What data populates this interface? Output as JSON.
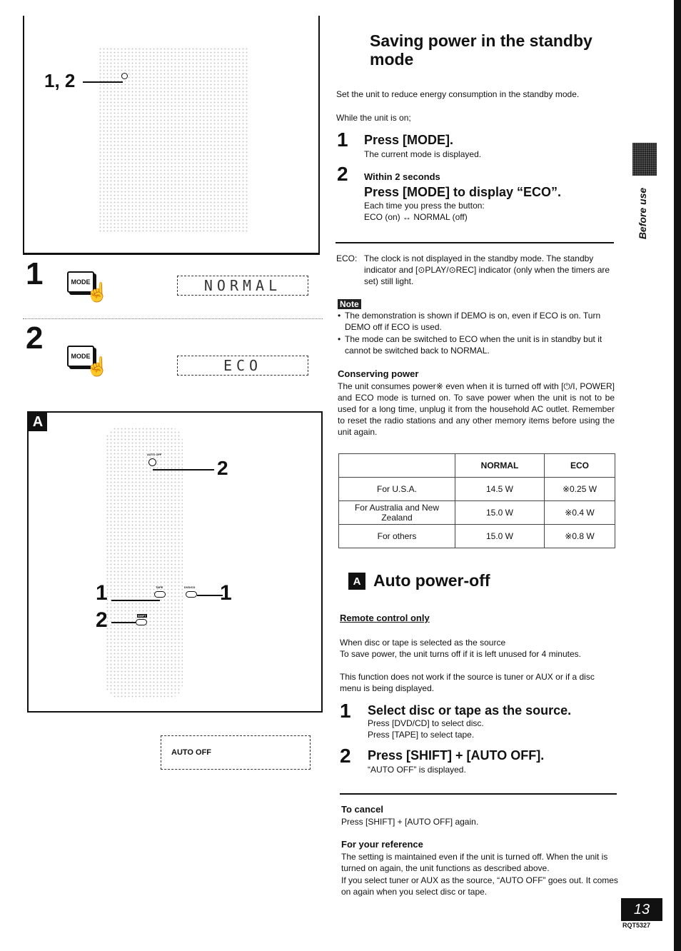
{
  "page": {
    "side_tab_label": "Before use",
    "page_number": "13",
    "doc_code": "RQT5327"
  },
  "figures": {
    "top_callout": "1, 2",
    "step1_number": "1",
    "step2_number": "2",
    "mode_button_label": "MODE",
    "display_normal": "NORMAL",
    "display_eco": "ECO",
    "section_a_badge": "A",
    "remote_callouts": {
      "auto_off": "2",
      "tape": "1",
      "dvd_cd": "1",
      "shift": "2"
    },
    "remote_button_labels": {
      "auto_off": "AUTO OFF",
      "tape": "TAPE",
      "dvd_cd": "DVD/CD",
      "shift": "SHIFT"
    },
    "auto_off_display": "AUTO OFF"
  },
  "standby": {
    "title": "Saving power in the standby mode",
    "intro": "Set the unit to reduce energy consumption in the standby mode.",
    "while_on": "While the unit is on;",
    "steps": [
      {
        "number": "1",
        "title": "Press [MODE].",
        "desc": "The current mode is displayed."
      },
      {
        "number": "2",
        "pre": "Within 2 seconds",
        "title": "Press [MODE] to display “ECO”.",
        "desc_lines": [
          "Each time you press the button:",
          "ECO (on) ↔ NORMAL (off)"
        ]
      }
    ],
    "eco_label": "ECO:",
    "eco_desc": "The clock is not displayed in the standby mode. The standby indicator and [⊙PLAY/⊙REC] indicator (only when the timers are set) still light.",
    "note_label": "Note",
    "notes": [
      "The demonstration is shown if DEMO is on, even if ECO is on. Turn DEMO off if ECO is used.",
      "The mode can be switched to ECO when the unit is in standby but it cannot be switched back to NORMAL."
    ],
    "conserving_title": "Conserving power",
    "conserving_text": "The unit consumes power※ even when it is turned off with [⏻/I, POWER] and ECO mode is turned on. To save power when the unit is not to be used for a long time, unplug it from the household AC outlet. Remember to reset the radio stations and any other memory items before using the unit again.",
    "table": {
      "headers": [
        "",
        "NORMAL",
        "ECO"
      ],
      "rows": [
        [
          "For U.S.A.",
          "14.5 W",
          "※0.25 W"
        ],
        [
          "For Australia and New Zealand",
          "15.0 W",
          "※0.4 W"
        ],
        [
          "For others",
          "15.0 W",
          "※0.8 W"
        ]
      ]
    }
  },
  "autopower": {
    "badge": "A",
    "title": "Auto power-off",
    "remote_only": "Remote control only",
    "p1_lines": [
      "When disc or tape is selected as the source",
      "To save power, the unit turns off if it is left unused for 4 minutes."
    ],
    "p2": "This function does not work if the source is tuner or AUX or if a disc menu is being displayed.",
    "steps": [
      {
        "number": "1",
        "title": "Select disc or tape as the source.",
        "desc_lines": [
          "Press [DVD/CD] to select disc.",
          "Press [TAPE] to select tape."
        ]
      },
      {
        "number": "2",
        "title": "Press [SHIFT] + [AUTO OFF].",
        "desc_lines": [
          "“AUTO OFF” is displayed."
        ]
      }
    ],
    "cancel_title": "To cancel",
    "cancel_text": "Press [SHIFT] + [AUTO OFF] again.",
    "reference_title": "For your reference",
    "reference_lines": [
      "The setting is maintained even if the unit is turned off. When the unit is turned on again, the unit functions as described above.",
      "If you select tuner or AUX as the source, “AUTO OFF” goes out. It comes on again when you select disc or tape."
    ]
  }
}
